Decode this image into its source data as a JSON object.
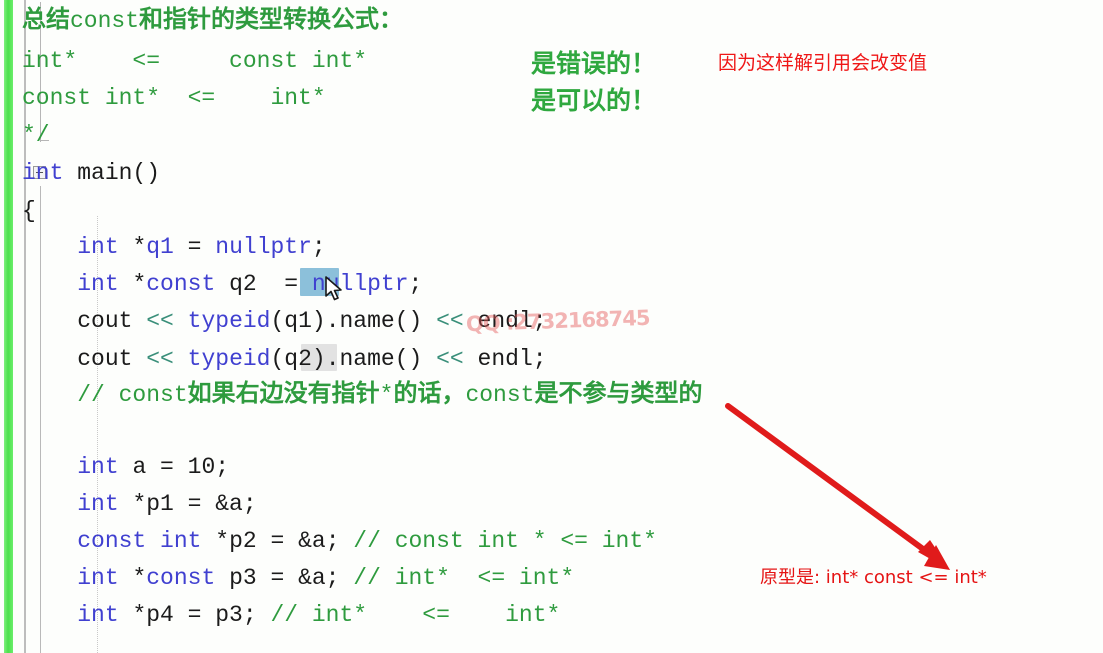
{
  "editor": {
    "background": "#fdfefc",
    "change_bar_color": "#5eec5e",
    "comment_color": "#2e9b3e",
    "keyword_color": "#4040d0",
    "plain_color": "#1b1b1b",
    "operator_color": "#3a8f7a",
    "selection_color": "#8cc0da",
    "annotation_red": "#ef1717",
    "annotation_green": "#2fa83f"
  },
  "code": {
    "lines": [
      {
        "id": "l1",
        "parts": [
          {
            "t": "总结",
            "c": "cn"
          },
          {
            "t": "const",
            "c": "cmt"
          },
          {
            "t": "和指针的类型转换公式：",
            "c": "cn"
          }
        ]
      },
      {
        "id": "l2",
        "parts": [
          {
            "t": "int*    <=     const int*",
            "c": "cmt"
          }
        ]
      },
      {
        "id": "l3",
        "parts": [
          {
            "t": "const int*  <=    int*",
            "c": "cmt"
          }
        ]
      },
      {
        "id": "l4",
        "parts": [
          {
            "t": "*/",
            "c": "cmt"
          }
        ]
      },
      {
        "id": "l5",
        "parts": [
          {
            "t": "int",
            "c": "kw"
          },
          {
            "t": " main()",
            "c": "plain"
          }
        ]
      },
      {
        "id": "l6",
        "parts": [
          {
            "t": "{",
            "c": "plain"
          }
        ]
      },
      {
        "id": "l7",
        "parts": [
          {
            "t": "    ",
            "c": "plain"
          },
          {
            "t": "int",
            "c": "kw"
          },
          {
            "t": " *",
            "c": "plain"
          },
          {
            "t": "q1",
            "c": "kw"
          },
          {
            "t": " = ",
            "c": "plain"
          },
          {
            "t": "nullptr",
            "c": "kw"
          },
          {
            "t": ";",
            "c": "plain"
          }
        ]
      },
      {
        "id": "l8",
        "parts": [
          {
            "t": "    ",
            "c": "plain"
          },
          {
            "t": "int",
            "c": "kw"
          },
          {
            "t": " *",
            "c": "plain"
          },
          {
            "t": "const",
            "c": "kw"
          },
          {
            "t": " ",
            "c": "plain"
          },
          {
            "t": "q2",
            "c": "plain"
          },
          {
            "t": "  = ",
            "c": "plain"
          },
          {
            "t": "nullptr",
            "c": "kw"
          },
          {
            "t": ";",
            "c": "plain"
          }
        ]
      },
      {
        "id": "l9",
        "parts": [
          {
            "t": "    cout ",
            "c": "plain"
          },
          {
            "t": "<<",
            "c": "op"
          },
          {
            "t": " ",
            "c": "plain"
          },
          {
            "t": "typeid",
            "c": "kw"
          },
          {
            "t": "(q1).name() ",
            "c": "plain"
          },
          {
            "t": "<<",
            "c": "op"
          },
          {
            "t": " endl;",
            "c": "plain"
          }
        ]
      },
      {
        "id": "l10",
        "parts": [
          {
            "t": "    cout ",
            "c": "plain"
          },
          {
            "t": "<<",
            "c": "op"
          },
          {
            "t": " ",
            "c": "plain"
          },
          {
            "t": "typeid",
            "c": "kw"
          },
          {
            "t": "(q2).name() ",
            "c": "plain"
          },
          {
            "t": "<<",
            "c": "op"
          },
          {
            "t": " endl;",
            "c": "plain"
          }
        ]
      },
      {
        "id": "l11",
        "parts": [
          {
            "t": "    // const",
            "c": "cmt"
          },
          {
            "t": "如果右边没有指针",
            "c": "cn"
          },
          {
            "t": "*",
            "c": "cmt"
          },
          {
            "t": "的话，",
            "c": "cn"
          },
          {
            "t": "const",
            "c": "cmt"
          },
          {
            "t": "是不参与类型的",
            "c": "cn"
          }
        ]
      },
      {
        "id": "l12",
        "parts": [
          {
            "t": "",
            "c": "plain"
          }
        ]
      },
      {
        "id": "l13",
        "parts": [
          {
            "t": "    ",
            "c": "plain"
          },
          {
            "t": "int",
            "c": "kw"
          },
          {
            "t": " a = ",
            "c": "plain"
          },
          {
            "t": "10",
            "c": "plain"
          },
          {
            "t": ";",
            "c": "plain"
          }
        ]
      },
      {
        "id": "l14",
        "parts": [
          {
            "t": "    ",
            "c": "plain"
          },
          {
            "t": "int",
            "c": "kw"
          },
          {
            "t": " *p1 = &a;",
            "c": "plain"
          }
        ]
      },
      {
        "id": "l15",
        "parts": [
          {
            "t": "    ",
            "c": "plain"
          },
          {
            "t": "const",
            "c": "kw"
          },
          {
            "t": " ",
            "c": "plain"
          },
          {
            "t": "int",
            "c": "kw"
          },
          {
            "t": " *p2 = &a; ",
            "c": "plain"
          },
          {
            "t": "// const int * <= int*",
            "c": "cmt"
          }
        ]
      },
      {
        "id": "l16",
        "parts": [
          {
            "t": "    ",
            "c": "plain"
          },
          {
            "t": "int",
            "c": "kw"
          },
          {
            "t": " *",
            "c": "plain"
          },
          {
            "t": "const",
            "c": "kw"
          },
          {
            "t": " p3 = &a; ",
            "c": "plain"
          },
          {
            "t": "// int*  <= int*",
            "c": "cmt"
          }
        ]
      },
      {
        "id": "l17",
        "parts": [
          {
            "t": "    ",
            "c": "plain"
          },
          {
            "t": "int",
            "c": "kw"
          },
          {
            "t": " *p4 = p3; ",
            "c": "plain"
          },
          {
            "t": "// int*    <=    int*",
            "c": "cmt"
          }
        ]
      }
    ]
  },
  "annotations": {
    "green_wrong": "是错误的！",
    "green_ok": "是可以的！",
    "red_reason": "因为这样解引用会改变值",
    "red_prototype": "原型是: int* const <= int*"
  },
  "watermark": {
    "text": "QQ :2732168745"
  },
  "selection": {
    "selected_token": "q2",
    "soft_highlight_token": "q2"
  }
}
